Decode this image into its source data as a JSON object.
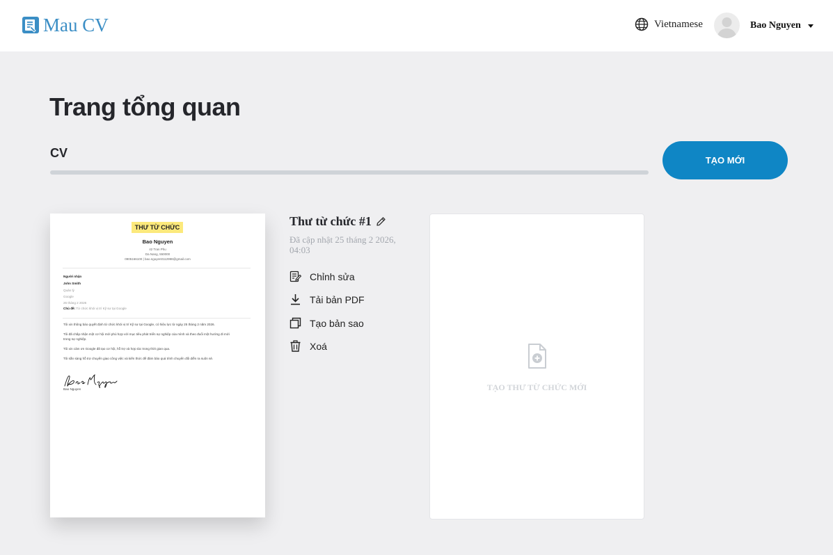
{
  "header": {
    "logo_text": "Mau CV",
    "language": "Vietnamese",
    "user_name": "Bao Nguyen"
  },
  "main": {
    "page_title": "Trang tổng quan",
    "tab_label": "CV",
    "new_button_label": "TẠO MỚI"
  },
  "document": {
    "title": "Thư từ chức #1",
    "updated": "Đã cập nhật 25 tháng 2 2026, 04:03",
    "actions": [
      {
        "label": "Chỉnh sửa",
        "icon": "edit-icon"
      },
      {
        "label": "Tải bản PDF",
        "icon": "download-icon"
      },
      {
        "label": "Tạo bản sao",
        "icon": "copy-icon"
      },
      {
        "label": "Xoá",
        "icon": "trash-icon"
      }
    ]
  },
  "preview": {
    "heading": "THƯ TỪ CHỨC",
    "name": "Bao Nguyen",
    "address1": "42 Tran Phu",
    "address2": "Da Nang, 550000",
    "contact": "0905166100 | bao.nguyen0112998@gmail.com",
    "recipient_label": "Người nhận",
    "recipient_name": "John Smith",
    "recipient_role": "Quản lý",
    "recipient_company": "Google",
    "date": "26 tháng 2 2026",
    "subject_label": "Chủ đề:",
    "subject": "Từ chức khỏi vị trí Kỹ sư tại Google",
    "para1": "Tôi xin thông báo quyết định từ chức khỏi vị trí Kỹ sư tại Google, có hiệu lực từ ngày 25 tháng 2 năm 2026.",
    "para2a": "Tôi đã chấp nhận một cơ hội mới phù hợp với mục tiêu phát triển sự nghiệp của mình và theo đuổi một hướng đi mới",
    "para2b": "trong sự nghiệp.",
    "para3": "Tôi xin cảm ơn Google đã tạo cơ hội, hỗ trợ và hợp tác trong thời gian qua.",
    "para4": "Tôi sẵn sàng hỗ trợ chuyển giao công việc và kiến thức để đảm bảo quá trình chuyển đổi diễn ra suôn sẻ.",
    "signer": "Bao Nguyen"
  },
  "new_card": {
    "label": "TẠO THƯ TỪ CHỨC MỚI",
    "icon": "add-file-icon"
  },
  "colors": {
    "primary": "#0f86c5",
    "logo": "#3b8ec5",
    "highlight": "#fce97c",
    "background": "#efeff1"
  }
}
